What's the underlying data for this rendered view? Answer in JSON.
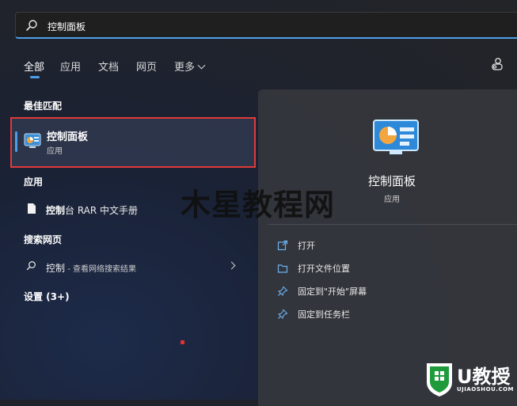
{
  "search": {
    "value": "控制面板",
    "icon": "search-icon"
  },
  "tabs": [
    {
      "label": "全部",
      "active": true
    },
    {
      "label": "应用"
    },
    {
      "label": "文档"
    },
    {
      "label": "网页"
    },
    {
      "label": "更多"
    }
  ],
  "sections": {
    "best_match": "最佳匹配",
    "apps": "应用",
    "web_search": "搜索网页",
    "settings": "设置 (3+)"
  },
  "best_match": {
    "name": "控制面板",
    "type": "应用",
    "icon": "control-panel-icon"
  },
  "apps": [
    {
      "name_bold": "控制",
      "name_rest": "台 RAR 中文手册",
      "icon": "document-icon"
    }
  ],
  "web_search": {
    "query": "控制",
    "suffix": " - 查看网络搜索结果",
    "icon": "search-icon"
  },
  "detail_panel": {
    "title": "控制面板",
    "subtitle": "应用",
    "actions": [
      {
        "label": "打开",
        "icon": "open-icon"
      },
      {
        "label": "打开文件位置",
        "icon": "folder-icon"
      },
      {
        "label": "固定到\"开始\"屏幕",
        "icon": "pin-icon"
      },
      {
        "label": "固定到任务栏",
        "icon": "pin-icon"
      }
    ]
  },
  "watermark": "木星教程网",
  "logo": {
    "text": "U教授",
    "sub": "UJIAOSHOU.COM"
  },
  "colors": {
    "accent": "#4c9ee8",
    "highlight_border": "#e03a3a",
    "logo_green": "#1f9b3c"
  }
}
